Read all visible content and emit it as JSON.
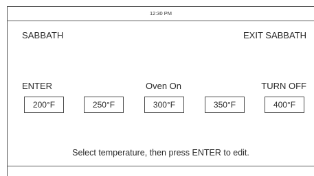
{
  "status_bar": {
    "time": "12:30 PM"
  },
  "header": {
    "title": "SABBATH",
    "exit_label": "EXIT SABBATH"
  },
  "actions": {
    "enter_label": "ENTER",
    "oven_status": "Oven On",
    "turn_off_label": "TURN OFF"
  },
  "temperatures": [
    "200°F",
    "250°F",
    "300°F",
    "350°F",
    "400°F"
  ],
  "footer": {
    "instruction": "Select temperature, then press ENTER to edit."
  }
}
